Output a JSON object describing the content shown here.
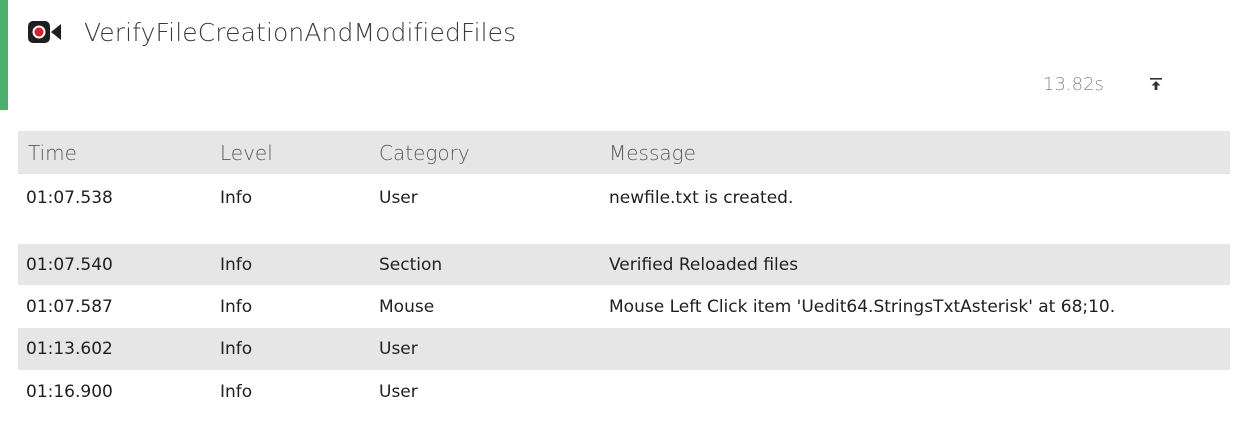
{
  "test": {
    "title": "VerifyFileCreationAndModifiedFiles",
    "duration": "13.82s"
  },
  "icons": {
    "record": "video-record-icon",
    "collapse": "arrow-up-to-line-icon"
  },
  "colors": {
    "accent": "#4caf6e",
    "record_red": "#d9202c",
    "row_shade": "#e6e6e6"
  },
  "table": {
    "columns": [
      "Time",
      "Level",
      "Category",
      "Message"
    ],
    "rows": [
      {
        "time": "01:07.538",
        "level": "Info",
        "category": "User",
        "message": "newfile.txt is created."
      },
      {
        "time": "01:07.540",
        "level": "Info",
        "category": "Section",
        "message": "Verified Reloaded files"
      },
      {
        "time": "01:07.587",
        "level": "Info",
        "category": "Mouse",
        "message": "Mouse Left Click item 'Uedit64.StringsTxtAsterisk' at 68;10."
      },
      {
        "time": "01:13.602",
        "level": "Info",
        "category": "User",
        "message": ""
      },
      {
        "time": "01:16.900",
        "level": "Info",
        "category": "User",
        "message": ""
      }
    ]
  }
}
